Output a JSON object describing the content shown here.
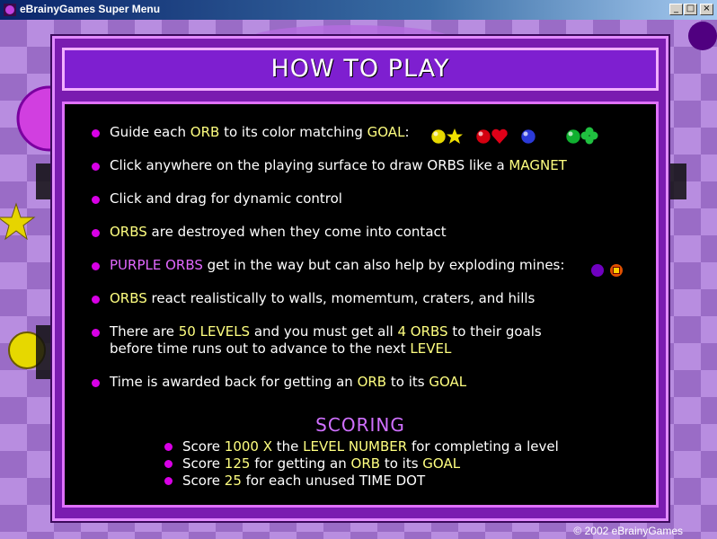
{
  "window": {
    "title": "eBrainyGames Super Menu",
    "minimize_label": "_",
    "maximize_label": "□",
    "close_label": "×"
  },
  "panel": {
    "heading": "HOW TO PLAY"
  },
  "rules": [
    {
      "parts": [
        {
          "t": "Guide each "
        },
        {
          "t": "ORB",
          "c": "hl"
        },
        {
          "t": " to its color matching "
        },
        {
          "t": "GOAL",
          "c": "hl"
        },
        {
          "t": ":"
        }
      ]
    },
    {
      "parts": [
        {
          "t": "Click anywhere on the playing surface to draw ORBS like a "
        },
        {
          "t": "MAGNET",
          "c": "hl"
        }
      ]
    },
    {
      "parts": [
        {
          "t": "Click and drag for dynamic control"
        }
      ]
    },
    {
      "parts": [
        {
          "t": "ORBS",
          "c": "hl"
        },
        {
          "t": " are destroyed when they come into contact"
        }
      ]
    },
    {
      "parts": [
        {
          "t": "PURPLE ORBS",
          "c": "pp"
        },
        {
          "t": " get in the way but can also help by exploding mines:"
        }
      ]
    },
    {
      "parts": [
        {
          "t": "ORBS",
          "c": "hl"
        },
        {
          "t": " react realistically to walls, momemtum, craters, and hills"
        }
      ]
    },
    {
      "parts": [
        {
          "t": "There are "
        },
        {
          "t": "50 LEVELS",
          "c": "hl"
        },
        {
          "t": " and you must get all "
        },
        {
          "t": "4 ORBS",
          "c": "hl"
        },
        {
          "t": " to their goals"
        }
      ],
      "line2": [
        {
          "t": "before time runs out to advance to the next "
        },
        {
          "t": "LEVEL",
          "c": "hl"
        }
      ]
    },
    {
      "parts": [
        {
          "t": "Time is awarded back for getting an "
        },
        {
          "t": "ORB",
          "c": "hl"
        },
        {
          "t": " to its "
        },
        {
          "t": "GOAL",
          "c": "hl"
        }
      ]
    }
  ],
  "goal_icons": [
    {
      "orb_color": "#e6d800",
      "symbol": "star",
      "symbol_color": "#f0e000",
      "name": "yellow-orb-star-goal-icon"
    },
    {
      "orb_color": "#d40010",
      "symbol": "heart",
      "symbol_color": "#e00018",
      "name": "red-orb-heart-goal-icon"
    },
    {
      "orb_color": "#2b3ad8",
      "symbol": "moon",
      "symbol_color": "#3040e0",
      "name": "blue-orb-moon-goal-icon"
    },
    {
      "orb_color": "#10b030",
      "symbol": "clover",
      "symbol_color": "#20c040",
      "name": "green-orb-clover-goal-icon"
    }
  ],
  "mine_icons": [
    {
      "name": "purple-orb-icon",
      "color": "#7000c0"
    },
    {
      "name": "mine-icon",
      "color": "#e05000"
    }
  ],
  "scoring": {
    "title": "SCORING",
    "items": [
      {
        "parts": [
          {
            "t": "Score "
          },
          {
            "t": "1000 X",
            "c": "hl"
          },
          {
            "t": " the "
          },
          {
            "t": "LEVEL NUMBER",
            "c": "hl"
          },
          {
            "t": " for completing a level"
          }
        ]
      },
      {
        "parts": [
          {
            "t": "Score "
          },
          {
            "t": "125",
            "c": "hl"
          },
          {
            "t": " for getting an "
          },
          {
            "t": "ORB",
            "c": "hl"
          },
          {
            "t": " to its "
          },
          {
            "t": "GOAL",
            "c": "hl"
          }
        ]
      },
      {
        "parts": [
          {
            "t": "Score "
          },
          {
            "t": "25",
            "c": "hl"
          },
          {
            "t": " for each unused "
          },
          {
            "t": "TIME DOT"
          }
        ]
      }
    ]
  },
  "copyright": "© 2002 eBrainyGames"
}
